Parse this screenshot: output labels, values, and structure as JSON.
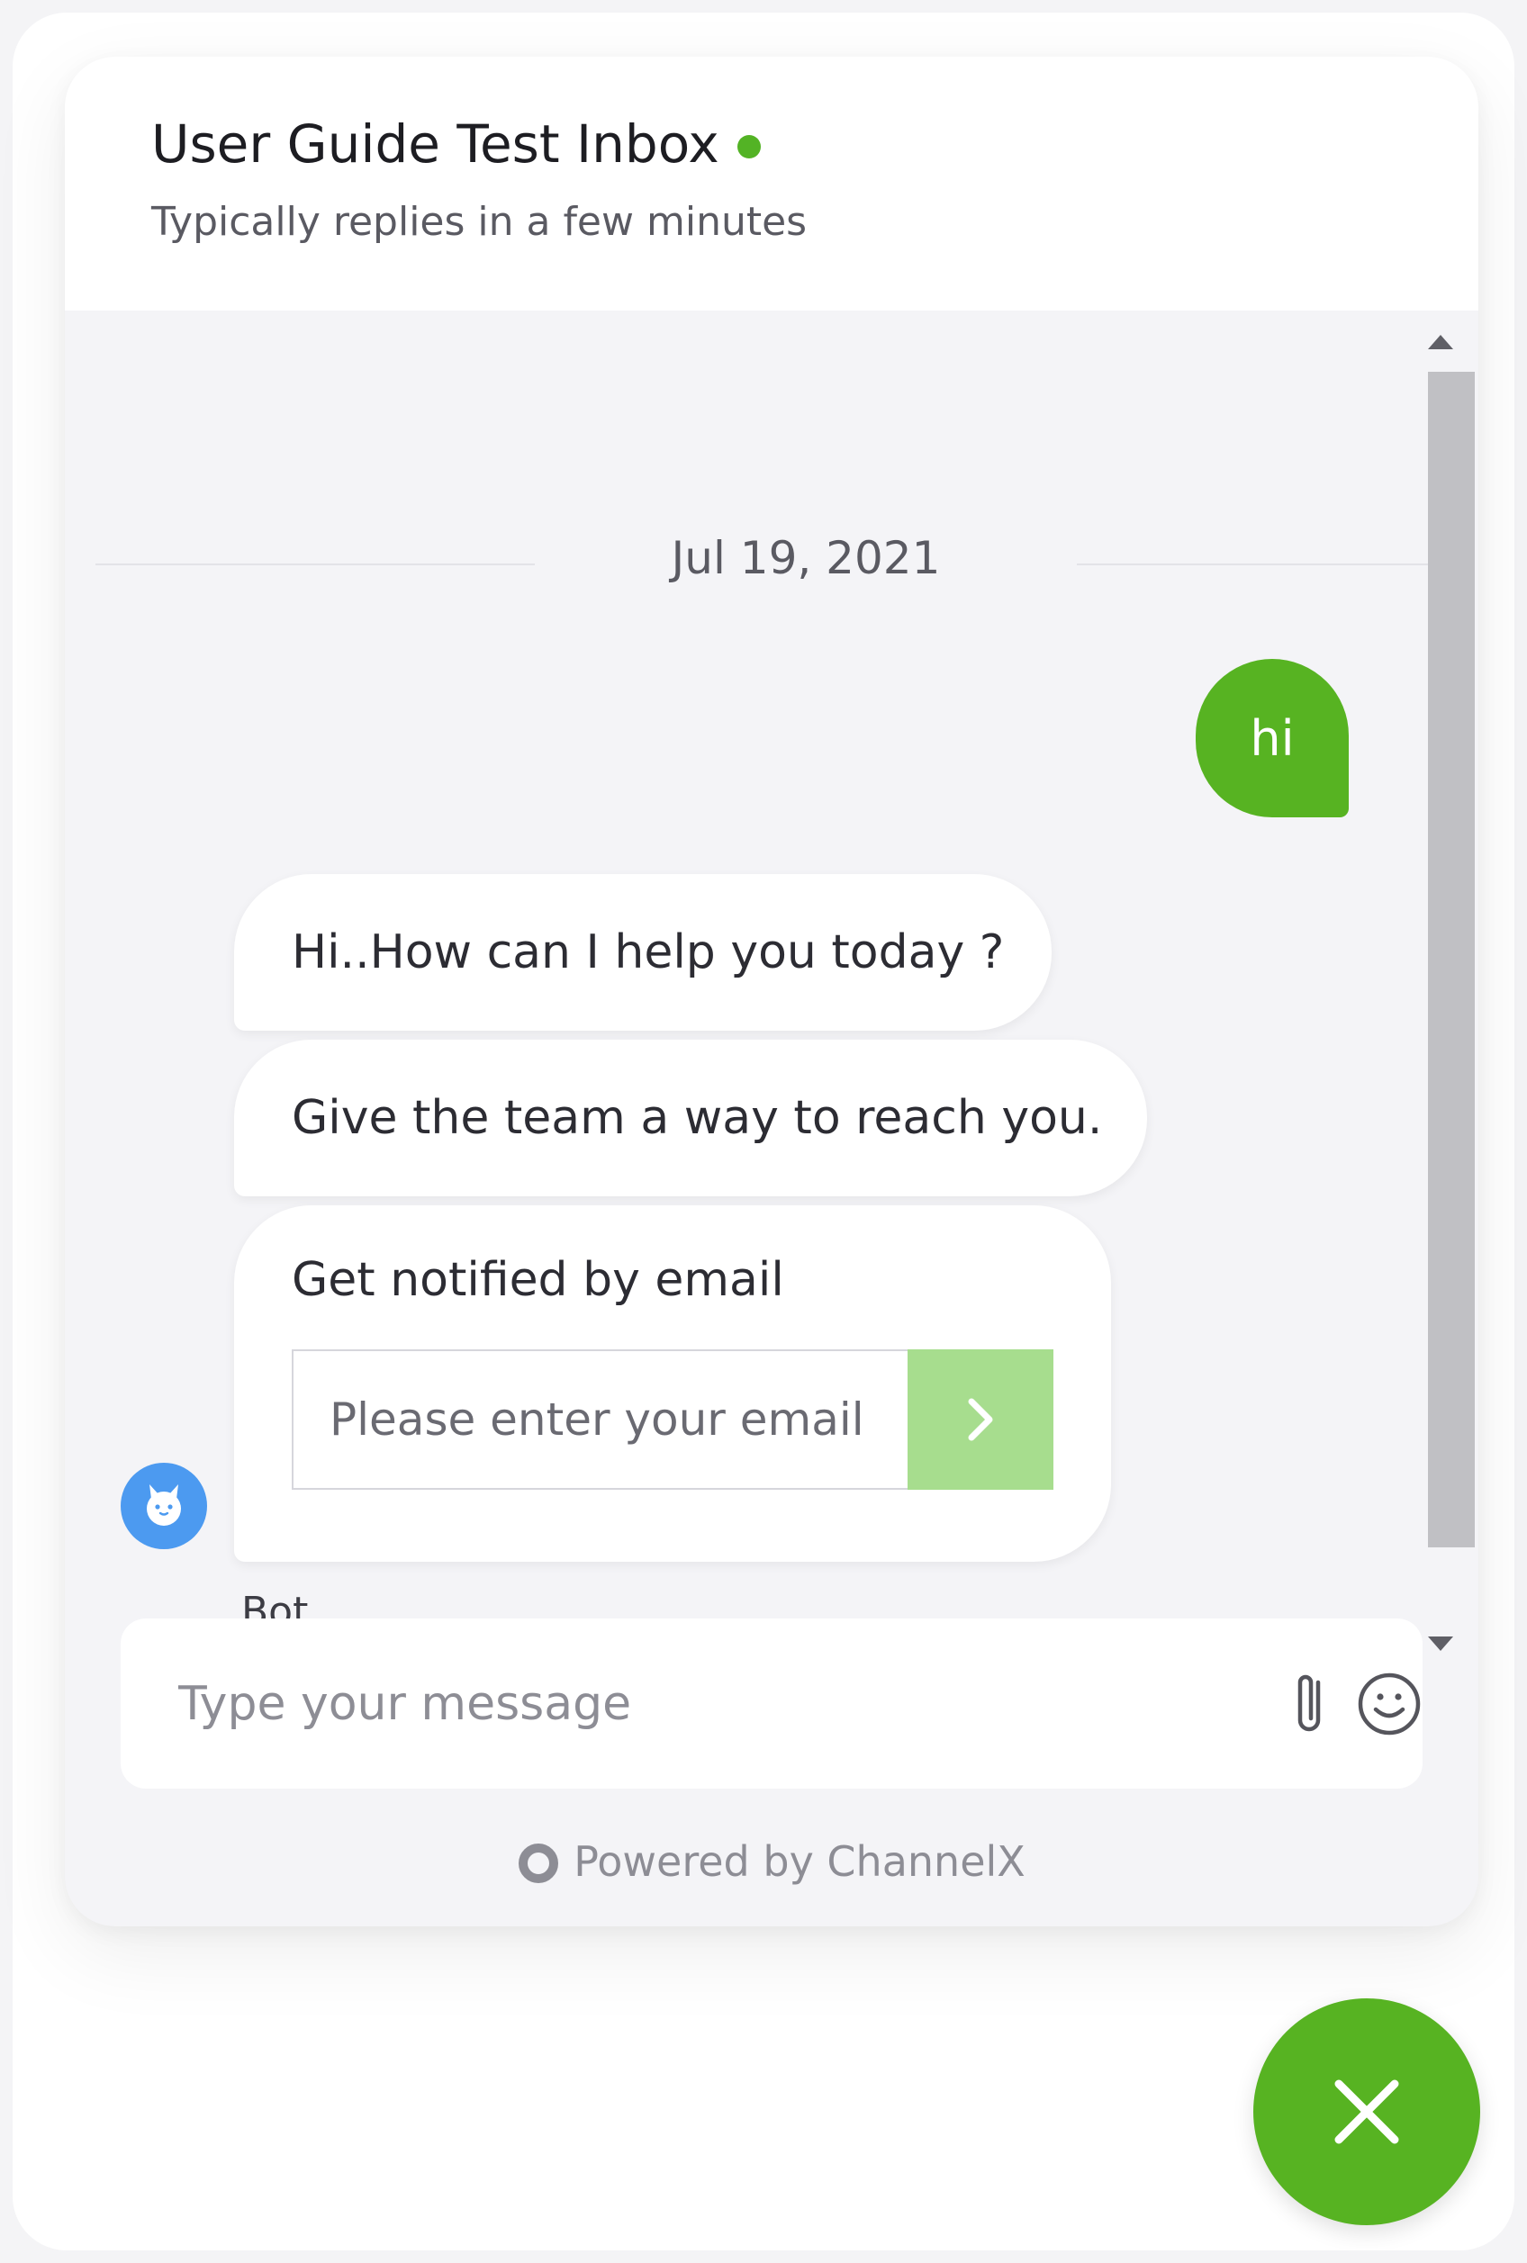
{
  "header": {
    "title": "User Guide Test Inbox",
    "status": "online",
    "subtitle": "Typically replies in a few minutes"
  },
  "conversation": {
    "date_divider": "Jul 19, 2021",
    "user_message": "hi",
    "bot_messages": [
      "Hi..How can I help you today ?",
      "Give the team a way to reach you."
    ],
    "email_card": {
      "label": "Get notified by email",
      "placeholder": "Please enter your email",
      "submit_icon": "chevron-right-icon"
    },
    "sender_name": "Bot",
    "avatar_icon": "bot-icon"
  },
  "composer": {
    "placeholder": "Type your message",
    "attach_icon": "paperclip-icon",
    "emoji_icon": "smiley-icon"
  },
  "footer": {
    "powered_by": "Powered by ChannelX"
  },
  "launcher": {
    "icon": "close-icon"
  },
  "colors": {
    "accent": "#57b322",
    "accent_light": "#a7dd8e",
    "avatar": "#4c9af0",
    "online": "#53b325"
  }
}
